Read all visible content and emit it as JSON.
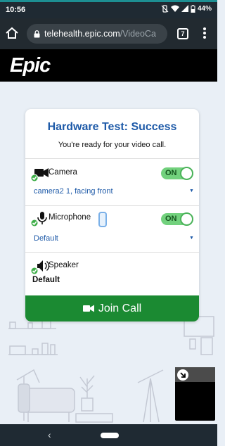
{
  "status_bar": {
    "time": "10:56",
    "battery": "44%"
  },
  "browser": {
    "url_host": "telehealth.epic.com",
    "url_path": "/VideoCa",
    "tab_count": "7"
  },
  "brand": {
    "logo_text": "Epic"
  },
  "card": {
    "title": "Hardware Test: Success",
    "subtitle": "You're ready for your video call."
  },
  "devices": {
    "camera": {
      "label": "Camera",
      "toggle": "ON",
      "selected": "camera2 1, facing front"
    },
    "microphone": {
      "label": "Microphone",
      "toggle": "ON",
      "selected": "Default"
    },
    "speaker": {
      "label": "Speaker",
      "value": "Default"
    }
  },
  "join_button": {
    "label": "Join Call"
  },
  "icons": {
    "check": "check-icon",
    "camera": "camera-icon",
    "microphone": "microphone-icon",
    "speaker": "speaker-icon",
    "video": "video-icon",
    "minimize": "minimize-icon"
  },
  "colors": {
    "accent_blue": "#1e5aa8",
    "success_green": "#1b8a32",
    "toggle_green": "#72d17d",
    "check_green": "#3fae49",
    "brand_black": "#000000",
    "chrome_dark": "#222a30"
  }
}
